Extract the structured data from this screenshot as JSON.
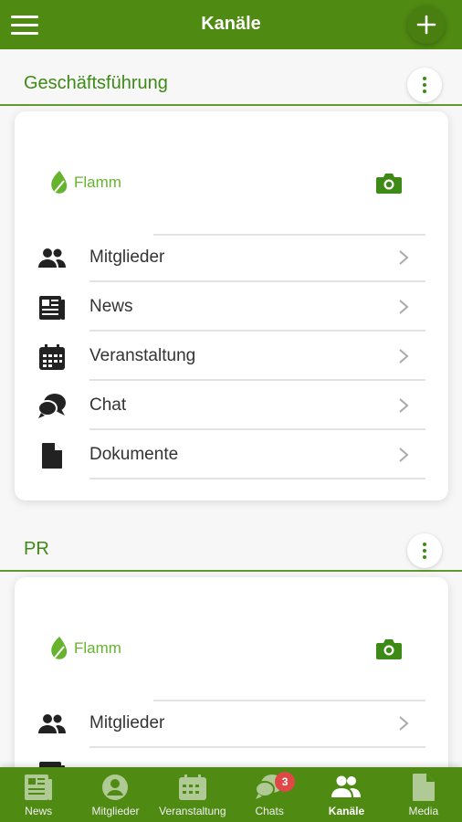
{
  "header": {
    "title": "Kanäle",
    "menu_icon": "hamburger-icon",
    "add_icon": "plus-icon"
  },
  "colors": {
    "brand": "#4f8a12",
    "accent_text": "#3d8a16",
    "logo_green": "#66b32e",
    "badge": "#e04848"
  },
  "channels": [
    {
      "name": "Geschäftsführung",
      "logo_text": "Flamm",
      "items": [
        {
          "label": "Mitglieder",
          "icon": "members-icon"
        },
        {
          "label": "News",
          "icon": "news-icon"
        },
        {
          "label": "Veranstaltung",
          "icon": "calendar-icon"
        },
        {
          "label": "Chat",
          "icon": "chat-icon"
        },
        {
          "label": "Dokumente",
          "icon": "document-icon"
        }
      ]
    },
    {
      "name": "PR",
      "logo_text": "Flamm",
      "items": [
        {
          "label": "Mitglieder",
          "icon": "members-icon"
        }
      ]
    }
  ],
  "bottom_nav": [
    {
      "label": "News",
      "icon": "news-icon",
      "active": false
    },
    {
      "label": "Mitglieder",
      "icon": "person-icon",
      "active": false
    },
    {
      "label": "Veranstaltung",
      "icon": "calendar-icon",
      "active": false
    },
    {
      "label": "Chats",
      "icon": "chat-icon",
      "active": false,
      "badge": "3"
    },
    {
      "label": "Kanäle",
      "icon": "group-icon",
      "active": true
    },
    {
      "label": "Media",
      "icon": "document-icon",
      "active": false
    }
  ]
}
